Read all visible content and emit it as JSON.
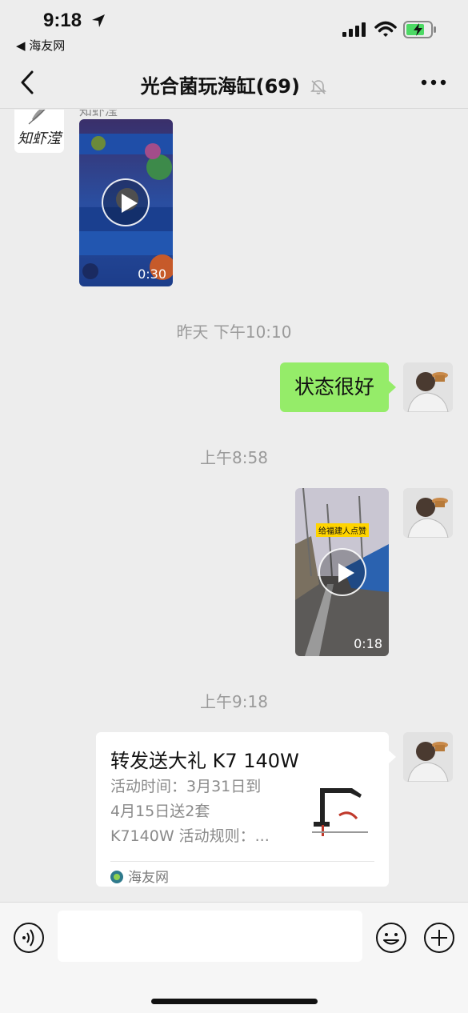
{
  "status_bar": {
    "time": "9:18",
    "back_app": "◀ 海友网"
  },
  "nav": {
    "title": "光合菌玩海缸(69)"
  },
  "messages": {
    "sender_name_partial": "知虾滢",
    "avatar_left_text": "知虾滢",
    "video1_duration": "0:30",
    "timestamp1": "昨天 下午10:10",
    "text_message": "状态很好",
    "timestamp2": "上午8:58",
    "video2_duration": "0:18",
    "video2_overlay": "给福建人点赞",
    "timestamp3": "上午9:18",
    "card": {
      "title": "转发送大礼 K7 140W",
      "desc_line1": "活动时间：3月31日到",
      "desc_line2": "4月15日送2套",
      "desc_line3": "K7140W 活动规则：...",
      "source": "海友网"
    }
  },
  "input": {
    "placeholder": ""
  },
  "colors": {
    "bubble_green": "#95ec69",
    "background": "#ededed"
  }
}
